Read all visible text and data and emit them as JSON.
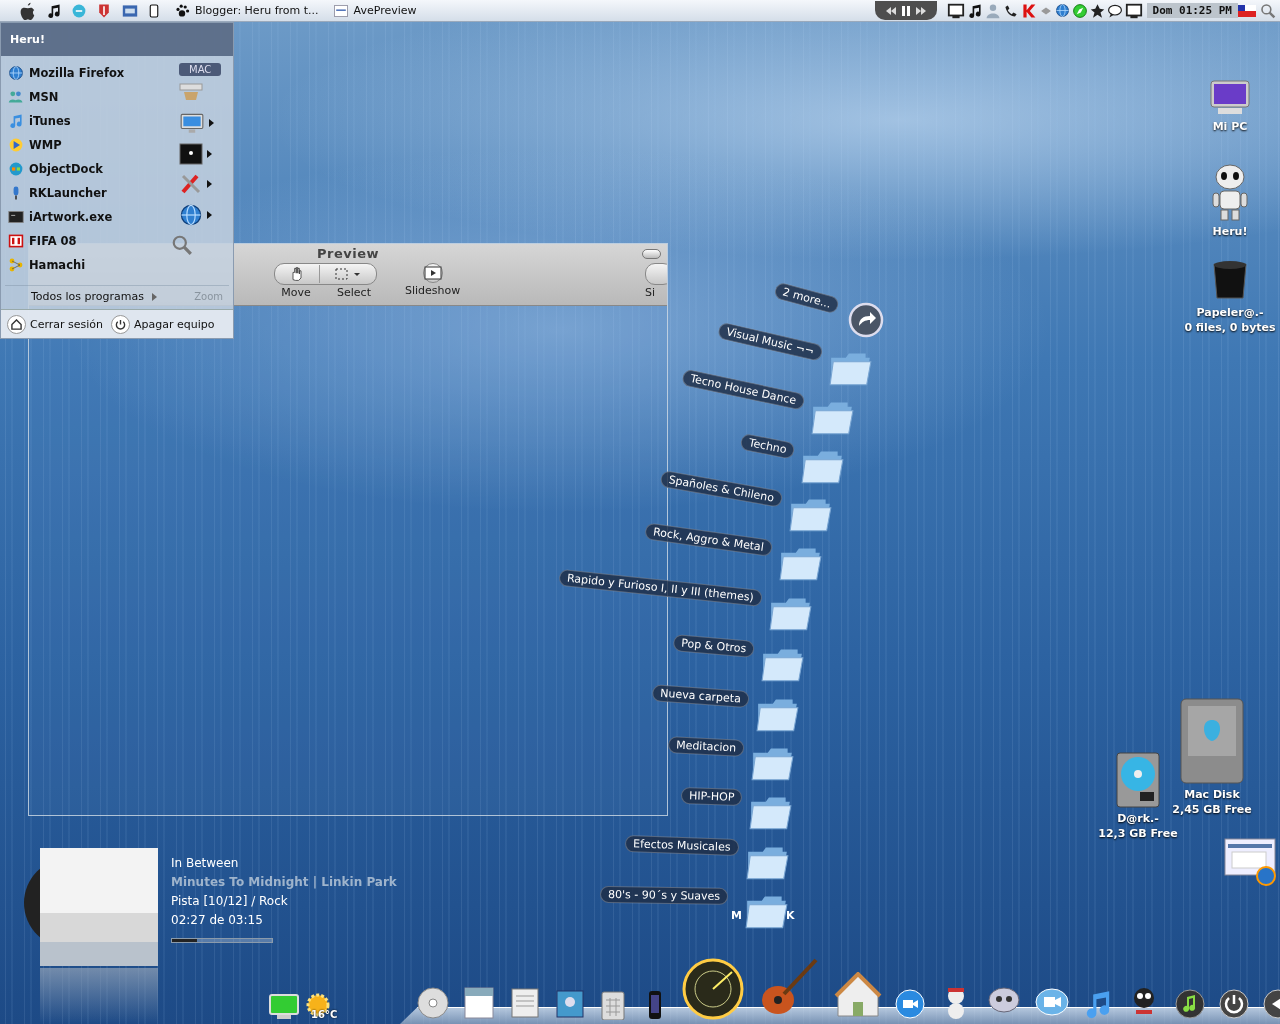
{
  "menu_bar": {
    "tasks": [
      {
        "title": "Blogger: Heru from t..."
      },
      {
        "title": "AvePreview"
      }
    ],
    "clock": "Dom 01:25 PM"
  },
  "start_menu": {
    "user": "Heru!",
    "programs": [
      "Mozilla Firefox",
      "MSN",
      "iTunes",
      "WMP",
      "ObjectDock",
      "RKLauncher",
      "iArtwork.exe",
      "FIFA 08",
      "Hamachi"
    ],
    "badge": "MAC",
    "all_programs": "Todos los programas",
    "actions": [
      "Cerrar sesión",
      "Apagar equipo"
    ]
  },
  "preview_window": {
    "title": "Preview",
    "tools": [
      "Zoom",
      "Move",
      "Select",
      "Slideshow",
      "Si"
    ]
  },
  "stack": {
    "more": "2 more...",
    "folders": [
      "Visual Music ¬¬",
      "Tecno House Dance",
      "Techno",
      "Spañoles & Chileno",
      "Rock, Aggro & Metal",
      "Rapido y Furioso I, II y III (themes)",
      "Pop & Otros",
      "Nueva carpeta",
      "Meditacion",
      "HIP-HOP",
      "Efectos Musicales",
      "80's - 90´s y Suaves"
    ],
    "letters": [
      "M",
      "K"
    ]
  },
  "desktop_icons": [
    {
      "kind": "computer",
      "label": "Mi PC"
    },
    {
      "kind": "robot",
      "label": "Heru!"
    },
    {
      "kind": "trash",
      "label": "Papeler@.-",
      "detail": "0 files, 0 bytes"
    },
    {
      "kind": "mac-disk",
      "label": "Mac Disk",
      "detail": "2,45 GB Free"
    },
    {
      "kind": "drive",
      "label": "D@rk.-",
      "detail": "12,3 GB Free"
    }
  ],
  "player": {
    "title": "In Between",
    "album": "Minutes To Midnight | Linkin Park",
    "track": "Pista [10/12] / Rock",
    "time": "02:27 de 03:15",
    "level": 0.25
  },
  "weather": {
    "temperature": "16°C"
  }
}
